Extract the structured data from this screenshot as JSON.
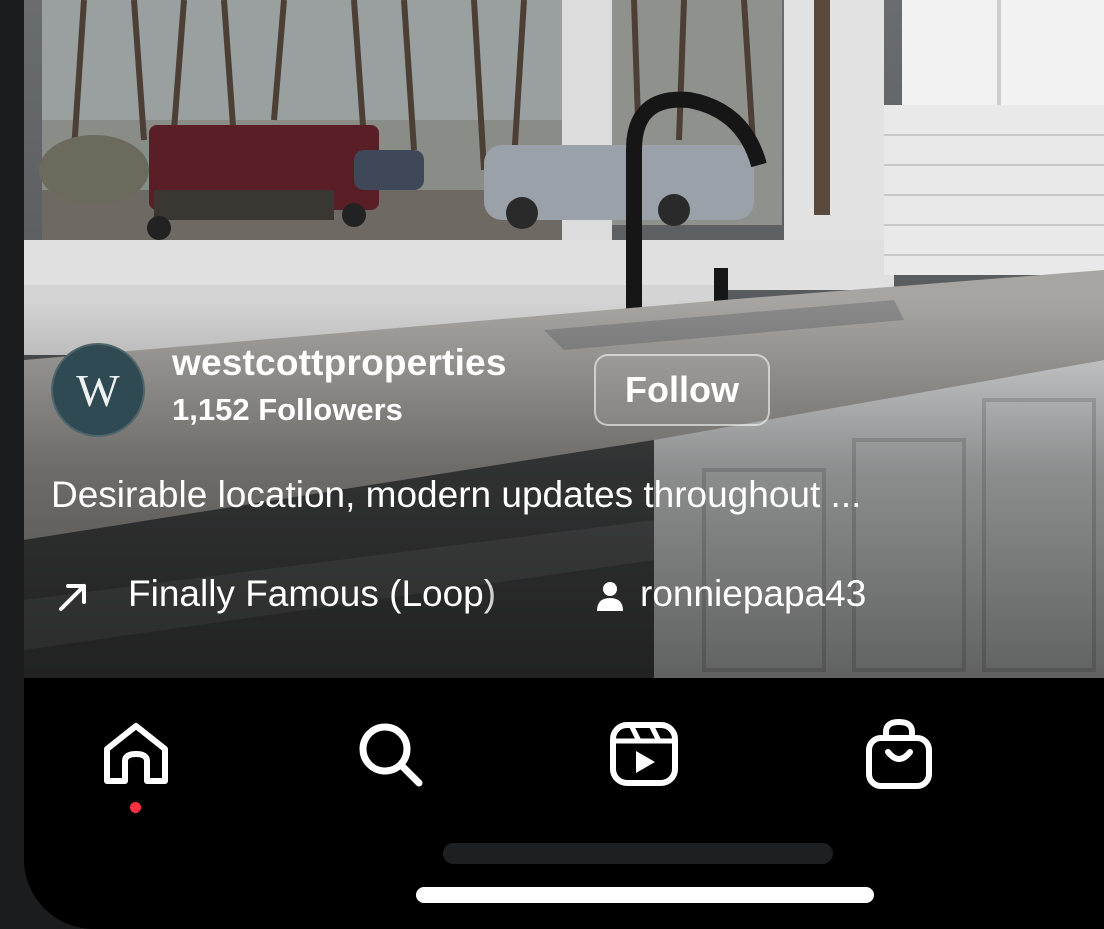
{
  "post": {
    "avatar_letter": "W",
    "username": "westcottproperties",
    "followers": "1,152 Followers",
    "follow_label": "Follow",
    "caption": "Desirable location, modern updates throughout ...",
    "audio_title": "Finally Famous (Loop)",
    "tagged_user": "ronniepapa43"
  },
  "nav": {
    "items": [
      {
        "icon": "home-icon",
        "active": true
      },
      {
        "icon": "search-icon",
        "active": false
      },
      {
        "icon": "reels-icon",
        "active": false
      },
      {
        "icon": "shop-icon",
        "active": false
      }
    ],
    "active_dot_color": "#ff3040"
  },
  "colors": {
    "avatar_bg": "#2f4a52",
    "background": "#000000",
    "text": "#ffffff"
  }
}
